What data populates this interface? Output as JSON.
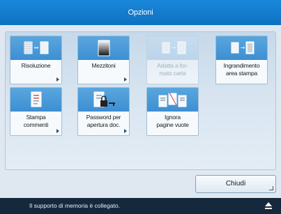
{
  "window": {
    "title": "Opzioni"
  },
  "tiles": [
    {
      "label": "Risoluzione",
      "icon": "resolution-icon",
      "disabled": false
    },
    {
      "label": "Mezzitoni",
      "icon": "halftone-icon",
      "disabled": false
    },
    {
      "label": "Adatta a for-\nmato carta",
      "icon": "fit-paper-icon",
      "disabled": true
    },
    {
      "label": "Ingrandimento\narea stampa",
      "icon": "enlarge-print-area-icon",
      "disabled": false
    },
    {
      "label": "Stampa\ncommenti",
      "icon": "print-comments-icon",
      "disabled": false
    },
    {
      "label": "Password per\napertura doc.",
      "icon": "doc-password-icon",
      "disabled": false
    },
    {
      "label": "Ignora\npagine vuote",
      "icon": "skip-blank-pages-icon",
      "disabled": false
    }
  ],
  "footer": {
    "close_label": "Chiudi"
  },
  "status": {
    "message": "Il supporto di memoria è collegato.",
    "icon": "eject-icon"
  }
}
